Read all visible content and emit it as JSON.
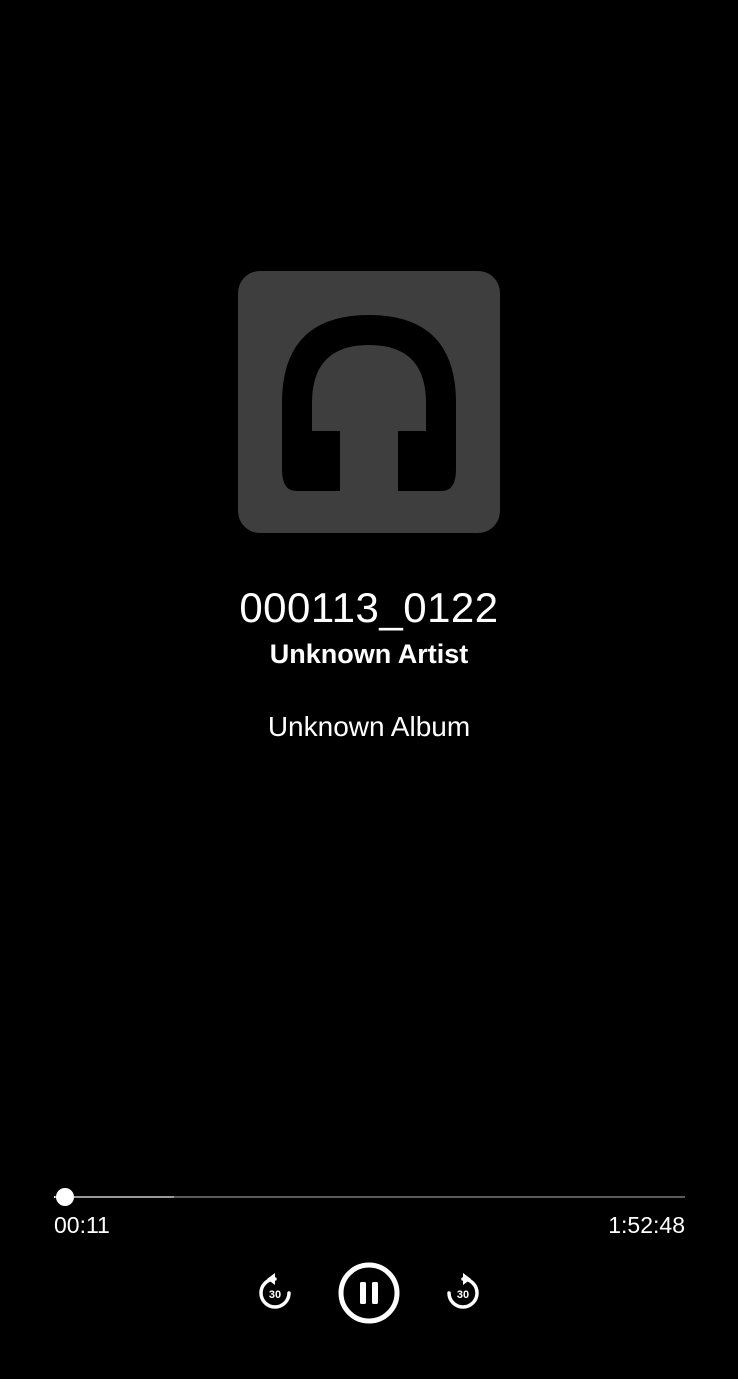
{
  "player": {
    "artwork_icon": "headphones-icon",
    "colors": {
      "background": "#000000",
      "artwork_bg": "#3e3e3e",
      "text": "#ffffff",
      "seek_track": "#5a5a5a",
      "seek_buffer": "#9a9a9a"
    },
    "track": {
      "title": "000113_0122",
      "artist": "Unknown Artist",
      "album": "Unknown Album"
    },
    "seek": {
      "elapsed": "00:11",
      "total": "1:52:48",
      "progress_fraction": 0.0016,
      "buffered_fraction": 0.19
    },
    "controls": {
      "rewind": {
        "icon": "replay-30-icon",
        "label": "30"
      },
      "play_pause": {
        "icon": "pause-icon",
        "state": "playing"
      },
      "forward": {
        "icon": "forward-30-icon",
        "label": "30"
      }
    }
  }
}
